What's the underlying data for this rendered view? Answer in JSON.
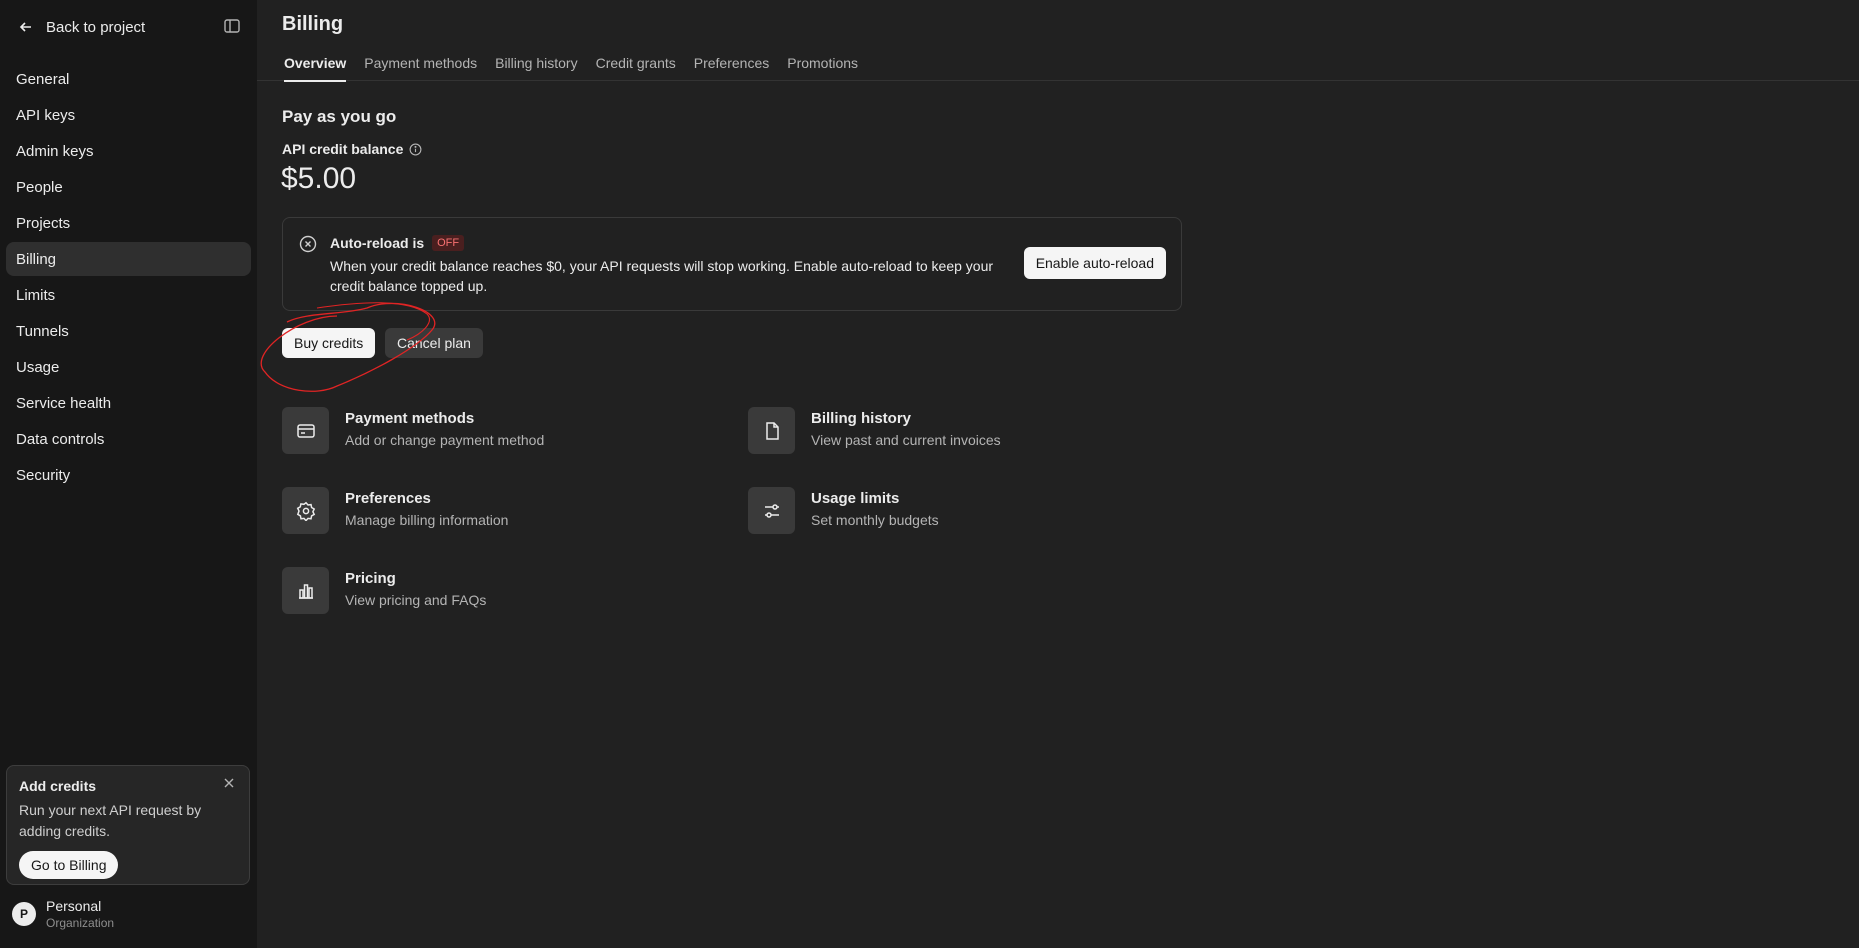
{
  "sidebar": {
    "back_label": "Back to project",
    "items": [
      {
        "label": "General"
      },
      {
        "label": "API keys"
      },
      {
        "label": "Admin keys"
      },
      {
        "label": "People"
      },
      {
        "label": "Projects"
      },
      {
        "label": "Billing",
        "active": true
      },
      {
        "label": "Limits"
      },
      {
        "label": "Tunnels"
      },
      {
        "label": "Usage"
      },
      {
        "label": "Service health"
      },
      {
        "label": "Data controls"
      },
      {
        "label": "Security"
      }
    ],
    "promo": {
      "title": "Add credits",
      "text": "Run your next API request by adding credits.",
      "button": "Go to Billing"
    },
    "org": {
      "initial": "P",
      "name": "Personal",
      "type": "Organization"
    }
  },
  "header": {
    "title": "Billing",
    "tabs": [
      {
        "label": "Overview",
        "active": true
      },
      {
        "label": "Payment methods"
      },
      {
        "label": "Billing history"
      },
      {
        "label": "Credit grants"
      },
      {
        "label": "Preferences"
      },
      {
        "label": "Promotions"
      }
    ]
  },
  "plan": {
    "title": "Pay as you go",
    "balance_label": "API credit balance",
    "balance_value": "$5.00"
  },
  "auto_reload": {
    "heading": "Auto-reload is",
    "status": "OFF",
    "text": "When your credit balance reaches $0, your API requests will stop working. Enable auto-reload to keep your credit balance topped up.",
    "button": "Enable auto-reload"
  },
  "actions": {
    "buy": "Buy credits",
    "cancel": "Cancel plan"
  },
  "links": [
    {
      "title": "Payment methods",
      "sub": "Add or change payment method",
      "icon": "credit-card-icon"
    },
    {
      "title": "Billing history",
      "sub": "View past and current invoices",
      "icon": "document-icon"
    },
    {
      "title": "Preferences",
      "sub": "Manage billing information",
      "icon": "gear-icon"
    },
    {
      "title": "Usage limits",
      "sub": "Set monthly budgets",
      "icon": "sliders-icon"
    },
    {
      "title": "Pricing",
      "sub": "View pricing and FAQs",
      "icon": "bar-chart-icon"
    }
  ],
  "colors": {
    "background": "#212121",
    "sidebar": "#171717",
    "annotation": "#e02424",
    "off_badge": "#f87171"
  }
}
